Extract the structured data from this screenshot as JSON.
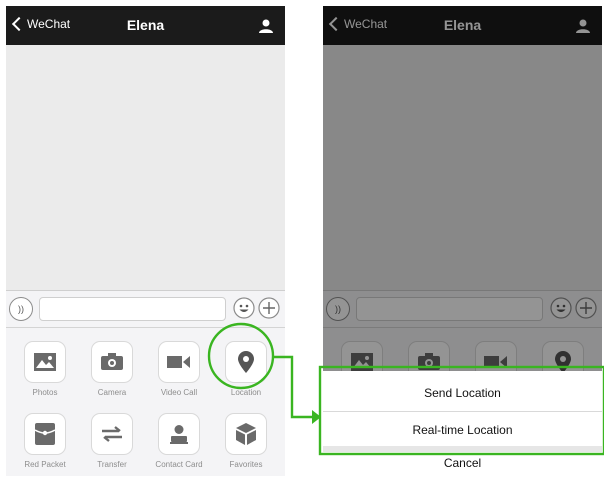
{
  "colors": {
    "accent": "#3ab521",
    "navbar": "#1b1b1b",
    "icon": "#6a6a6a",
    "dim": "rgba(0,0,0,0.42)"
  },
  "left_screen": {
    "nav": {
      "back_label": "WeChat",
      "title": "Elena",
      "contact_icon": "person-icon"
    },
    "input_bar": {
      "voice_icon": "voice-icon",
      "emoji_icon": "emoji-icon",
      "plus_icon": "plus-icon"
    },
    "panel_items": [
      {
        "label": "Photos",
        "icon": "photo-icon"
      },
      {
        "label": "Camera",
        "icon": "camera-icon"
      },
      {
        "label": "Video Call",
        "icon": "video-icon"
      },
      {
        "label": "Location",
        "icon": "location-pin-icon",
        "highlighted": true
      },
      {
        "label": "Red Packet",
        "icon": "red-packet-icon"
      },
      {
        "label": "Transfer",
        "icon": "transfer-icon"
      },
      {
        "label": "Contact Card",
        "icon": "contact-card-icon"
      },
      {
        "label": "Favorites",
        "icon": "favorites-icon"
      }
    ]
  },
  "right_screen": {
    "nav": {
      "back_label": "WeChat",
      "title": "Elena",
      "contact_icon": "person-icon"
    },
    "action_sheet": {
      "options": [
        "Send Location",
        "Real-time Location"
      ],
      "cancel": "Cancel",
      "highlighted": true
    }
  },
  "annotation": {
    "arrow": "arrow-right-icon",
    "from": "Location",
    "to": "action_sheet"
  }
}
